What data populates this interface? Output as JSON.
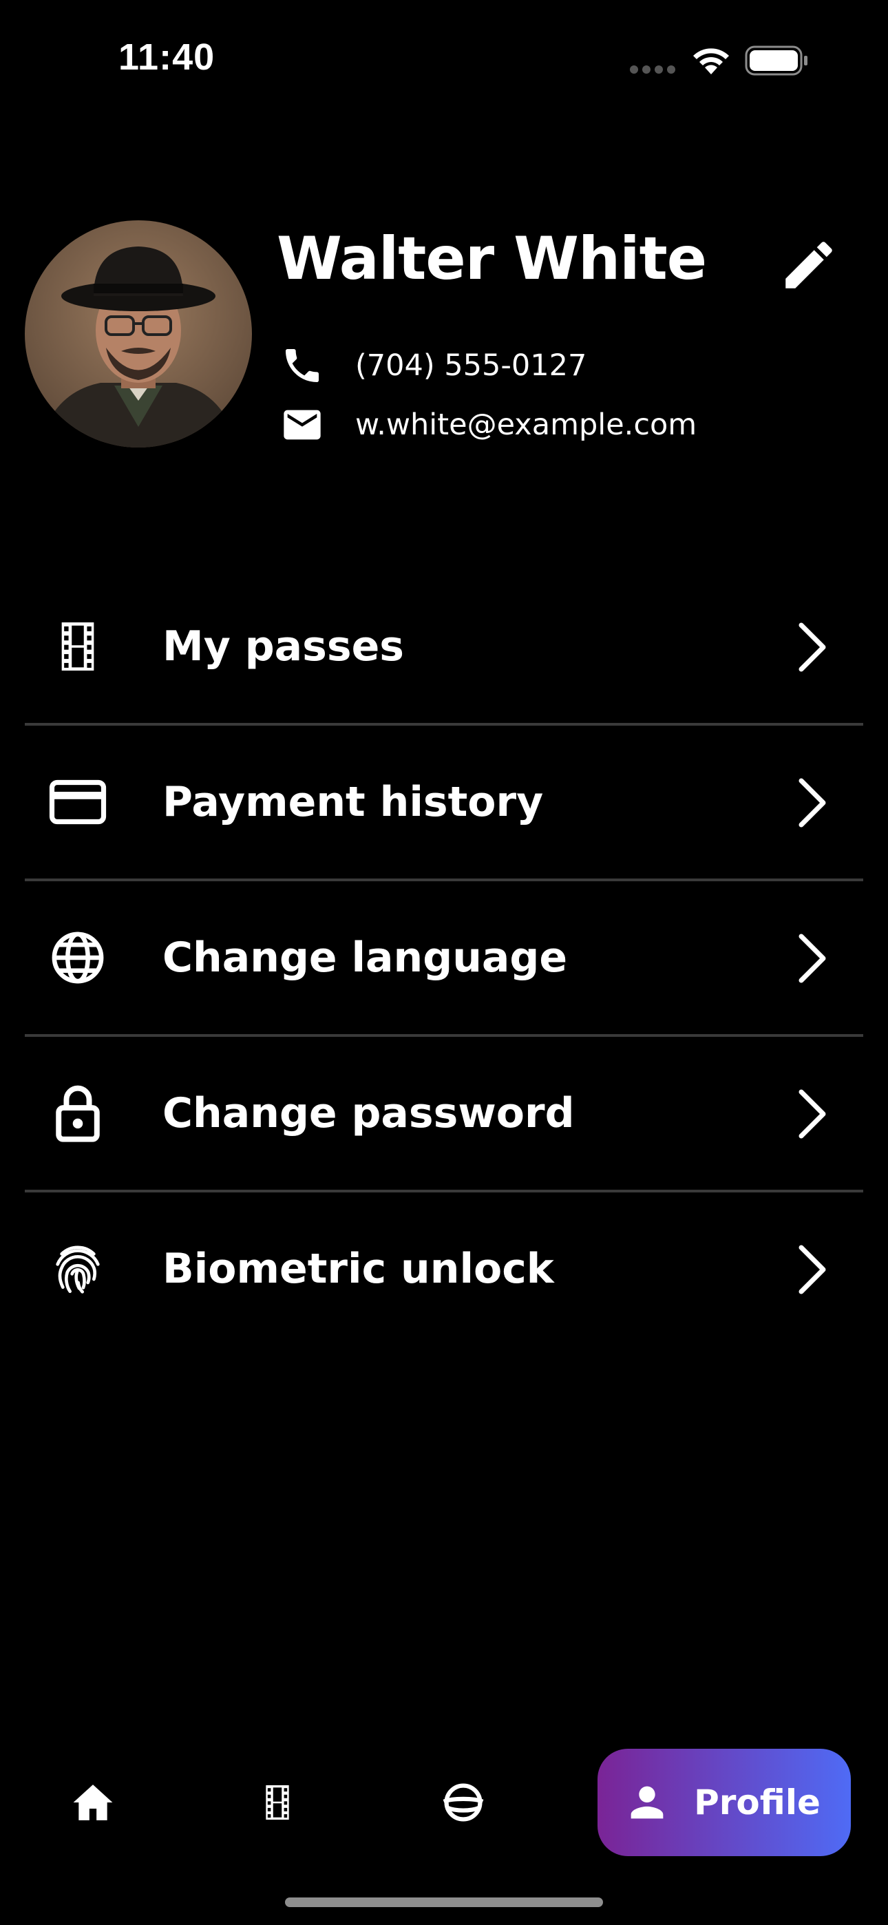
{
  "status_bar": {
    "time": "11:40"
  },
  "profile": {
    "name": "Walter White",
    "phone": "(704) 555-0127",
    "email": "w.white@example.com"
  },
  "menu": {
    "items": [
      {
        "label": "My passes",
        "icon": "film-icon"
      },
      {
        "label": "Payment history",
        "icon": "credit-card-icon"
      },
      {
        "label": "Change language",
        "icon": "globe-icon"
      },
      {
        "label": "Change password",
        "icon": "lock-icon"
      },
      {
        "label": "Biometric unlock",
        "icon": "fingerprint-icon"
      }
    ]
  },
  "bottom_nav": {
    "items": [
      {
        "icon": "home-icon"
      },
      {
        "icon": "film-icon"
      },
      {
        "icon": "planet-icon"
      },
      {
        "icon": "person-icon",
        "label": "Profile",
        "active": true
      }
    ]
  },
  "colors": {
    "background": "#000000",
    "text": "#ffffff",
    "divider": "#3a3a3a",
    "active_gradient_start": "#7a2496",
    "active_gradient_end": "#4f6bf5"
  }
}
